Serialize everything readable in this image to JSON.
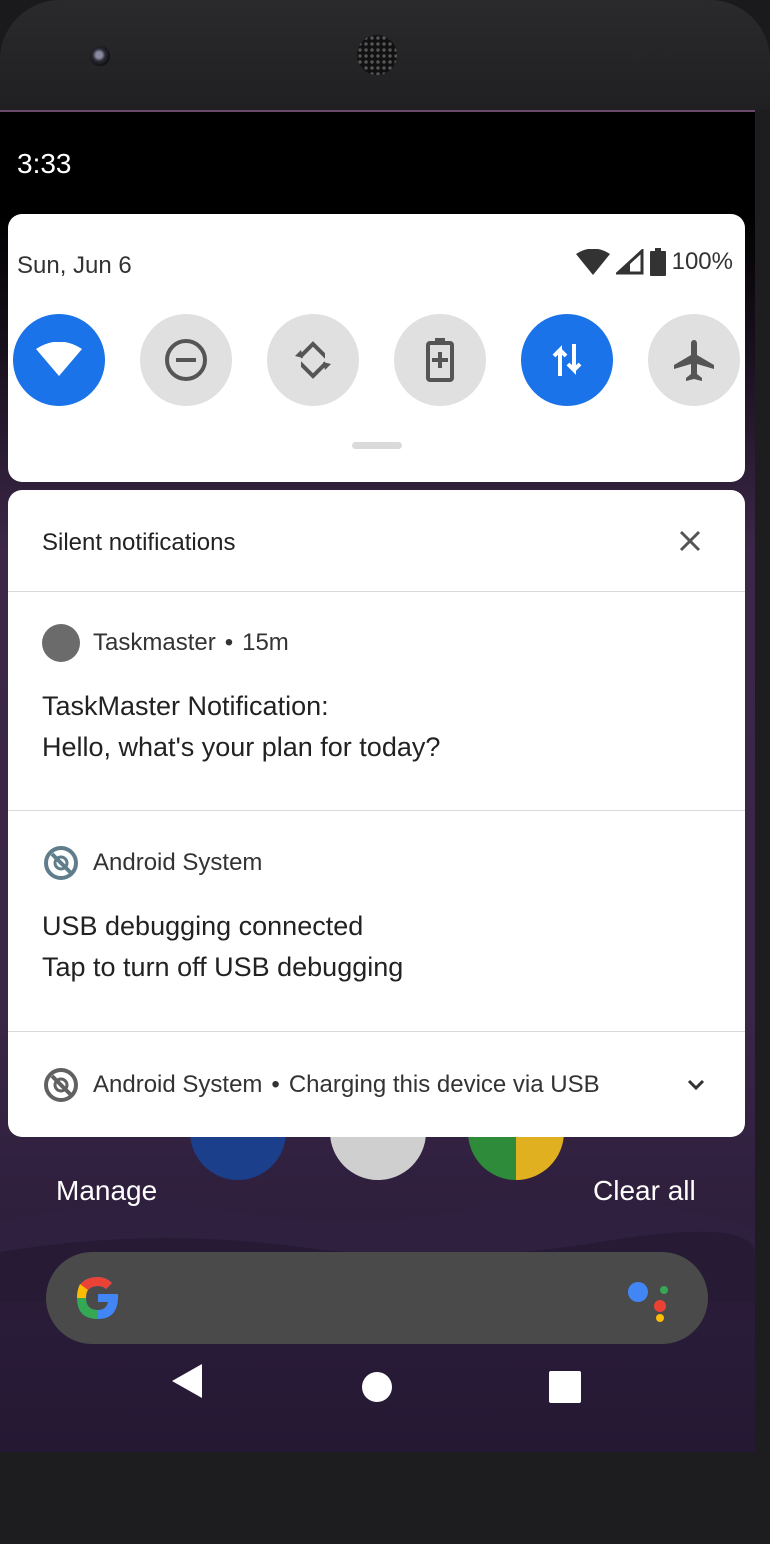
{
  "status_bar": {
    "time": "3:33"
  },
  "quick_settings": {
    "date": "Sun, Jun 6",
    "battery": "100%",
    "tiles": [
      {
        "name": "wifi",
        "on": true
      },
      {
        "name": "do-not-disturb",
        "on": false
      },
      {
        "name": "auto-rotate",
        "on": false
      },
      {
        "name": "battery-saver",
        "on": false
      },
      {
        "name": "mobile-data",
        "on": true
      },
      {
        "name": "airplane-mode",
        "on": false
      }
    ]
  },
  "notifications": {
    "section_title": "Silent notifications",
    "items": [
      {
        "app": "Taskmaster",
        "separator": "•",
        "time": "15m",
        "title": "TaskMaster Notification:",
        "text": "Hello, what's your plan for today?"
      },
      {
        "app": "Android System",
        "title": "USB debugging connected",
        "text": "Tap to turn off USB debugging"
      },
      {
        "app": "Android System",
        "separator": "•",
        "summary": "Charging this device via USB"
      }
    ]
  },
  "footer": {
    "manage": "Manage",
    "clear_all": "Clear all"
  },
  "colors": {
    "accent": "#1a73e8",
    "panel": "#ffffff",
    "tile_off": "#e0e0e0"
  }
}
